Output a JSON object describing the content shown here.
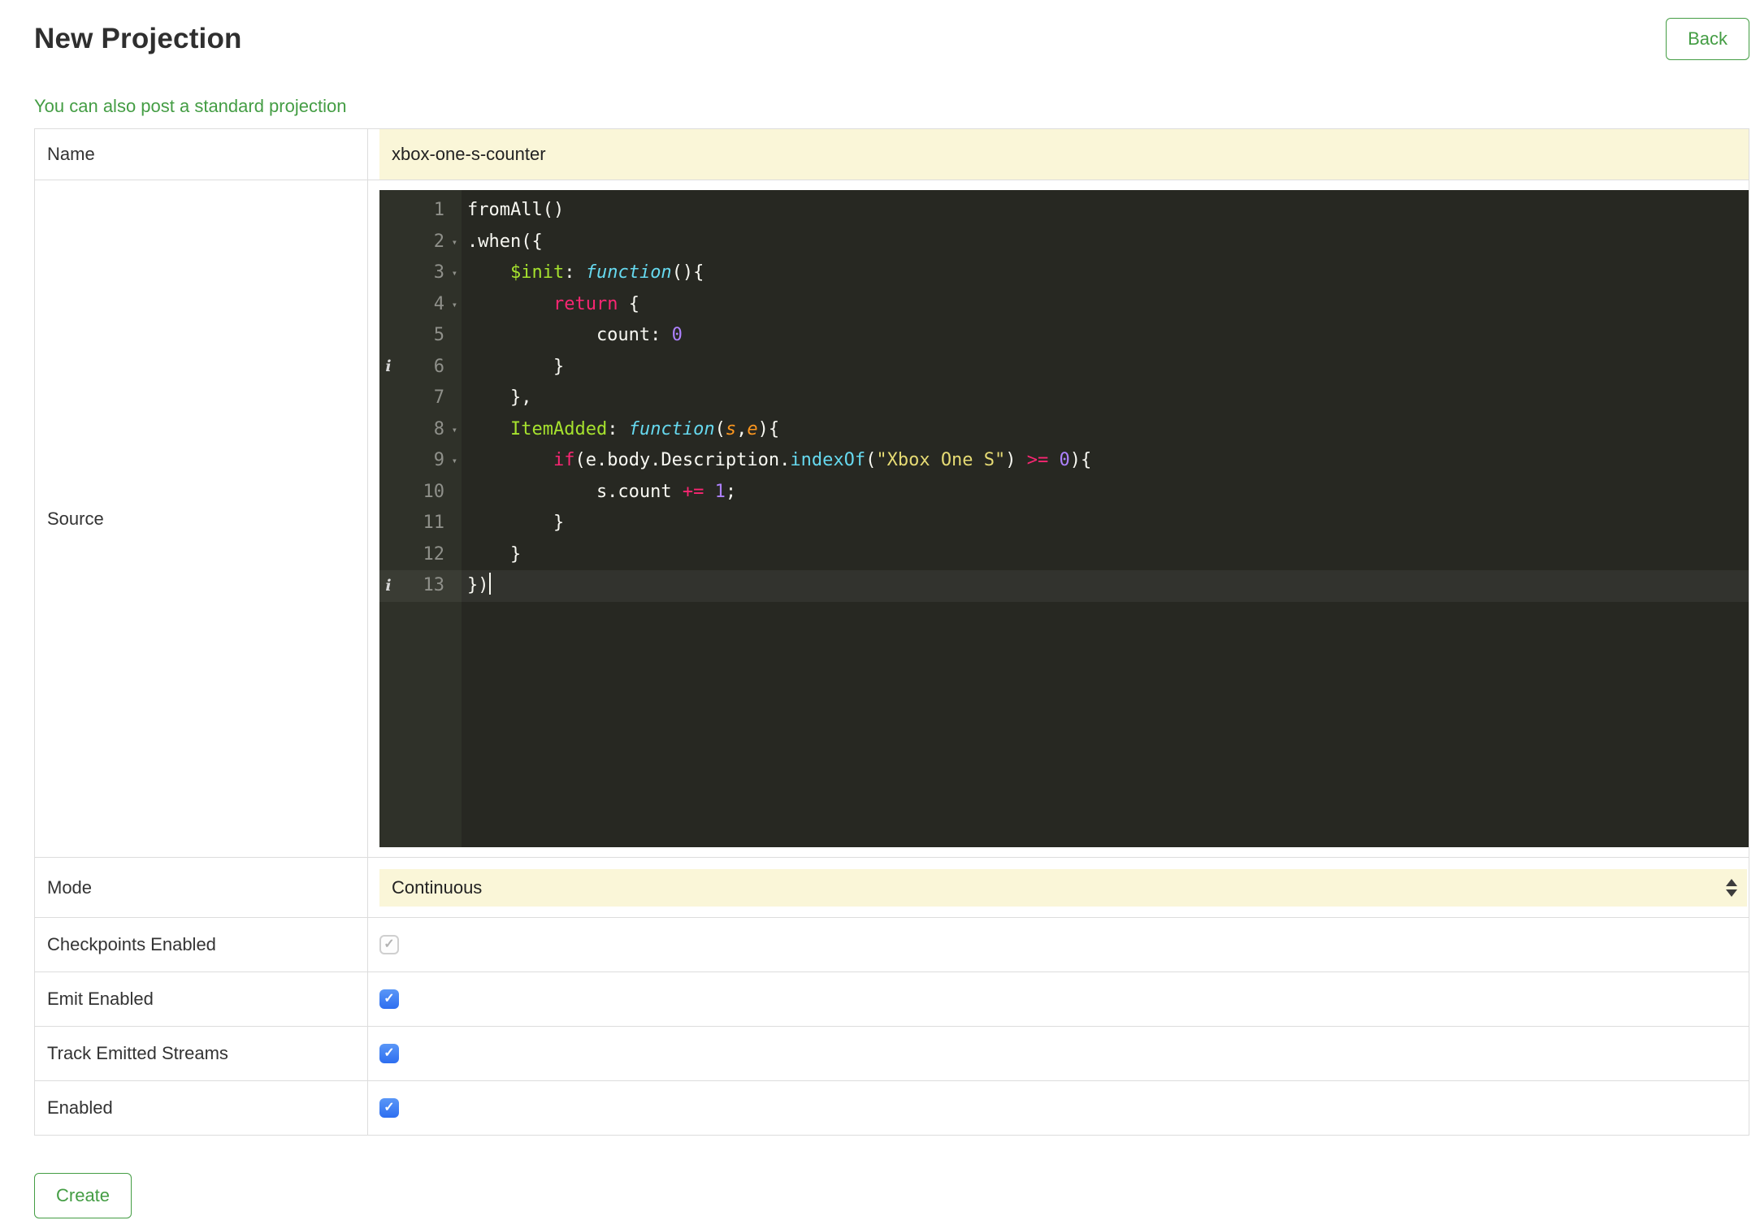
{
  "header": {
    "title": "New Projection",
    "back_label": "Back"
  },
  "subheader": {
    "link_text": "You can also post a standard projection"
  },
  "form": {
    "name": {
      "label": "Name",
      "value": "xbox-one-s-counter"
    },
    "source": {
      "label": "Source"
    },
    "mode": {
      "label": "Mode",
      "value": "Continuous"
    },
    "toggles": [
      {
        "label": "Checkpoints Enabled",
        "checked": true,
        "disabled": true
      },
      {
        "label": "Emit Enabled",
        "checked": true,
        "disabled": false
      },
      {
        "label": "Track Emitted Streams",
        "checked": true,
        "disabled": false
      },
      {
        "label": "Enabled",
        "checked": true,
        "disabled": false
      }
    ]
  },
  "footer": {
    "create_label": "Create"
  },
  "colors": {
    "accent_green": "#449d44",
    "input_yellow": "#faf6d8",
    "editor_bg": "#272822",
    "gutter_bg": "#2f3129",
    "keyword_pink": "#f92672",
    "function_cyan": "#66d9ef",
    "name_green": "#a6e22e",
    "param_orange": "#fd971f",
    "number_purple": "#ae81ff",
    "string_yellow": "#e6db74",
    "checkbox_blue": "#2f7cf6"
  },
  "editor": {
    "active_line": 13,
    "annotation_lines": [
      6,
      13
    ],
    "fold_lines": [
      2,
      3,
      4,
      8,
      9
    ],
    "lines": [
      {
        "n": 1,
        "tokens": [
          [
            "fromAll()",
            "plain"
          ]
        ]
      },
      {
        "n": 2,
        "tokens": [
          [
            ".when({",
            "plain"
          ]
        ]
      },
      {
        "n": 3,
        "tokens": [
          [
            "    ",
            "plain"
          ],
          [
            "$init",
            "key"
          ],
          [
            ": ",
            "plain"
          ],
          [
            "function",
            "func"
          ],
          [
            "(){",
            "plain"
          ]
        ]
      },
      {
        "n": 4,
        "tokens": [
          [
            "        ",
            "plain"
          ],
          [
            "return",
            "kw"
          ],
          [
            " {",
            "plain"
          ]
        ]
      },
      {
        "n": 5,
        "tokens": [
          [
            "            count: ",
            "plain"
          ],
          [
            "0",
            "num"
          ]
        ]
      },
      {
        "n": 6,
        "tokens": [
          [
            "        }",
            "plain"
          ]
        ]
      },
      {
        "n": 7,
        "tokens": [
          [
            "    },",
            "plain"
          ]
        ]
      },
      {
        "n": 8,
        "tokens": [
          [
            "    ",
            "plain"
          ],
          [
            "ItemAdded",
            "key"
          ],
          [
            ": ",
            "plain"
          ],
          [
            "function",
            "func"
          ],
          [
            "(",
            "plain"
          ],
          [
            "s",
            "param"
          ],
          [
            ",",
            "plain"
          ],
          [
            "e",
            "param"
          ],
          [
            "){",
            "plain"
          ]
        ]
      },
      {
        "n": 9,
        "tokens": [
          [
            "        ",
            "plain"
          ],
          [
            "if",
            "kw"
          ],
          [
            "(e.body.Description.",
            "plain"
          ],
          [
            "indexOf",
            "sfunc"
          ],
          [
            "(",
            "plain"
          ],
          [
            "\"Xbox One S\"",
            "str"
          ],
          [
            ") ",
            "plain"
          ],
          [
            ">=",
            "kw"
          ],
          [
            " ",
            "plain"
          ],
          [
            "0",
            "num"
          ],
          [
            "){",
            "plain"
          ]
        ]
      },
      {
        "n": 10,
        "tokens": [
          [
            "            s.count ",
            "plain"
          ],
          [
            "+=",
            "kw"
          ],
          [
            " ",
            "plain"
          ],
          [
            "1",
            "num"
          ],
          [
            ";",
            "plain"
          ]
        ]
      },
      {
        "n": 11,
        "tokens": [
          [
            "        }",
            "plain"
          ]
        ]
      },
      {
        "n": 12,
        "tokens": [
          [
            "    }",
            "plain"
          ]
        ]
      },
      {
        "n": 13,
        "tokens": [
          [
            "})",
            "plain"
          ]
        ],
        "cursor": true
      }
    ]
  }
}
